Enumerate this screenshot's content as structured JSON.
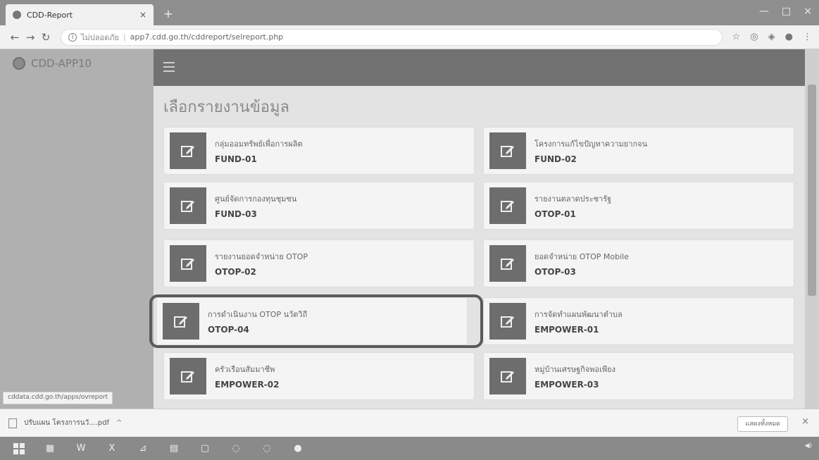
{
  "browser": {
    "tab_title": "CDD-Report",
    "tab_close": "×",
    "new_tab": "+",
    "window_controls": [
      "—",
      "□",
      "×"
    ],
    "address": {
      "security_label": "ไม่ปลอดภัย",
      "url": "app7.cdd.go.th/cddreport/selreport.php"
    }
  },
  "sidebar": {
    "brand": "CDD-APP10"
  },
  "main": {
    "title": "เลือกรายงานข้อมูล",
    "cards": [
      {
        "name": "กลุ่มออมทรัพย์เพื่อการผลิต",
        "code": "FUND-01"
      },
      {
        "name": "โครงการแก้ไขปัญหาความยากจน",
        "code": "FUND-02"
      },
      {
        "name": "ศูนย์จัดการกองทุนชุมชน",
        "code": "FUND-03"
      },
      {
        "name": "รายงานตลาดประชารัฐ",
        "code": "OTOP-01"
      },
      {
        "name": "รายงานยอดจำหน่าย OTOP",
        "code": "OTOP-02"
      },
      {
        "name": "ยอดจำหน่าย OTOP Mobile",
        "code": "OTOP-03"
      },
      {
        "name": "การดำเนินงาน OTOP นวัตวิถี",
        "code": "OTOP-04"
      },
      {
        "name": "การจัดทำแผนพัฒนาตำบล",
        "code": "EMPOWER-01"
      },
      {
        "name": "ครัวเรือนสัมมาชีพ",
        "code": "EMPOWER-02"
      },
      {
        "name": "หมู่บ้านเศรษฐกิจพอเพียง",
        "code": "EMPOWER-03"
      }
    ]
  },
  "status_url": "cddata.cdd.go.th/apps/ovreport",
  "downloads": {
    "file_name": "ปรับแผน โครงการนวั....pdf",
    "show_all": "แสดงทั้งหมด",
    "close": "×"
  },
  "colors": {
    "topbar": "#727272",
    "sidebar": "#b0b0b0",
    "card_icon_bg": "#6d6d6d",
    "highlight_border": "#5a5a5a"
  }
}
